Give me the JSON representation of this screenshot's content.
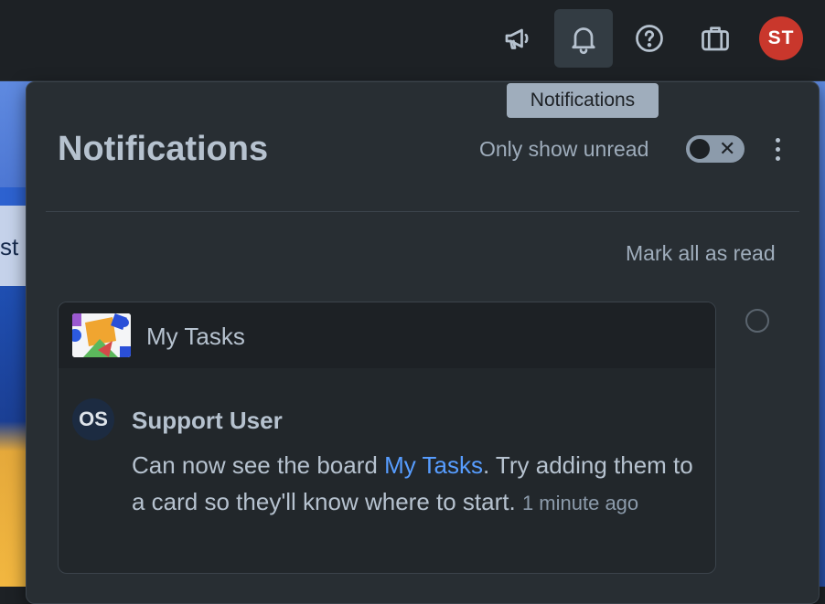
{
  "topbar": {
    "items": [
      {
        "icon": "megaphone-icon"
      },
      {
        "icon": "bell-icon"
      },
      {
        "icon": "help-circle-icon"
      },
      {
        "icon": "briefcase-icon"
      }
    ],
    "user_initials": "ST"
  },
  "background": {
    "board_fragment": "st"
  },
  "tooltip": {
    "text": "Notifications"
  },
  "panel": {
    "title": "Notifications",
    "unread_toggle_label": "Only show unread",
    "unread_toggle_on": false,
    "mark_all_label": "Mark all as read"
  },
  "notification": {
    "board_name": "My Tasks",
    "sender_initials": "OS",
    "sender": "Support User",
    "message_before": "Can now see the board ",
    "message_link": "My Tasks",
    "message_after": ". Try adding them to a card so they'll know where to start.",
    "time": "1 minute ago"
  },
  "colors": {
    "accent_link": "#579dff",
    "avatar_user": "#c9372c",
    "panel_bg": "#282e33"
  }
}
